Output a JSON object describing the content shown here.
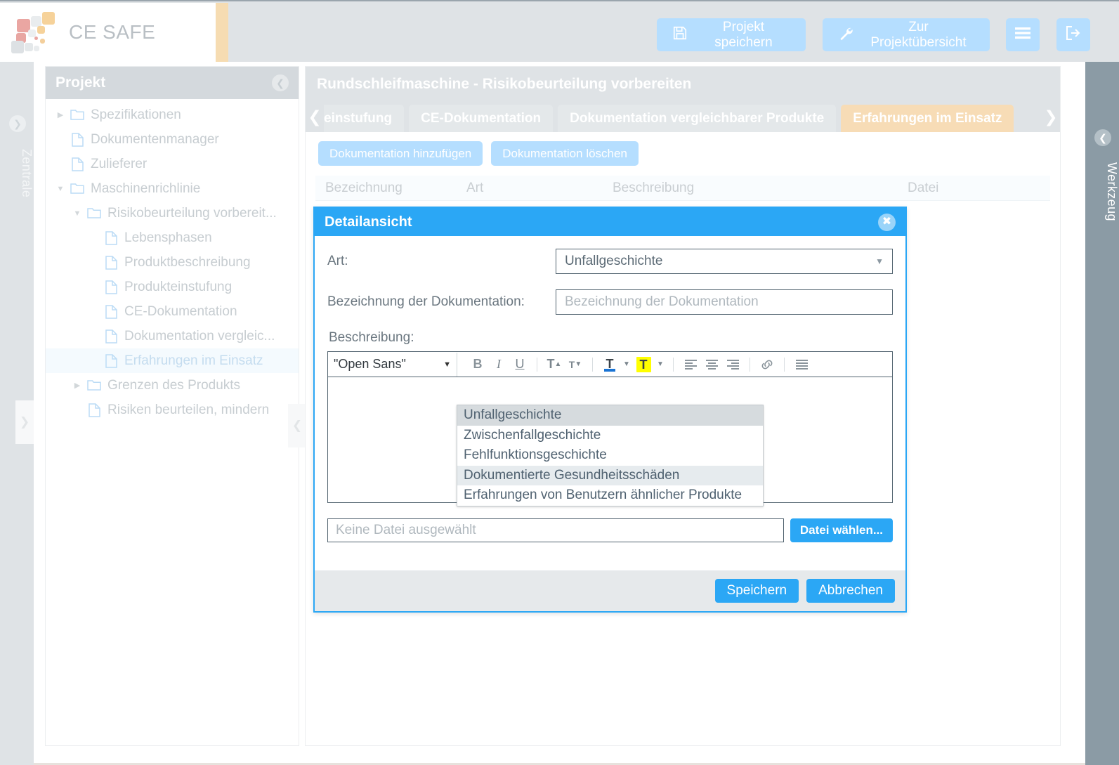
{
  "brand": {
    "name": "CE SAFE"
  },
  "topbar": {
    "save_project": "Projekt speichern",
    "overview": "Zur Projektübersicht",
    "menu_icon": "hamburger-menu-icon",
    "logout_icon": "logout-icon",
    "save_icon": "floppy-disk-icon",
    "wrench_icon": "wrench-icon"
  },
  "rails": {
    "left_label": "Zentrale",
    "right_label": "Werkzeug"
  },
  "tree": {
    "title": "Projekt",
    "items": [
      {
        "label": "Spezifikationen",
        "icon": "folder-icon",
        "indent": 0,
        "caret": "right",
        "selected": false
      },
      {
        "label": "Dokumentenmanager",
        "icon": "document-icon",
        "indent": 0,
        "caret": "none",
        "selected": false
      },
      {
        "label": "Zulieferer",
        "icon": "document-icon",
        "indent": 0,
        "caret": "none",
        "selected": false
      },
      {
        "label": "Maschinenrichlinie",
        "icon": "folder-icon",
        "indent": 0,
        "caret": "down",
        "selected": false
      },
      {
        "label": "Risikobeurteilung vorbereit...",
        "icon": "folder-icon",
        "indent": 1,
        "caret": "down",
        "selected": false
      },
      {
        "label": "Lebensphasen",
        "icon": "document-icon",
        "indent": 2,
        "caret": "none",
        "selected": false
      },
      {
        "label": "Produktbeschreibung",
        "icon": "document-icon",
        "indent": 2,
        "caret": "none",
        "selected": false
      },
      {
        "label": "Produkteinstufung",
        "icon": "document-icon",
        "indent": 2,
        "caret": "none",
        "selected": false
      },
      {
        "label": "CE-Dokumentation",
        "icon": "document-icon",
        "indent": 2,
        "caret": "none",
        "selected": false
      },
      {
        "label": "Dokumentation vergleic...",
        "icon": "document-icon",
        "indent": 2,
        "caret": "none",
        "selected": false
      },
      {
        "label": "Erfahrungen im Einsatz",
        "icon": "document-icon",
        "indent": 2,
        "caret": "none",
        "selected": true
      },
      {
        "label": "Grenzen des Produkts",
        "icon": "folder-icon",
        "indent": 1,
        "caret": "right",
        "selected": false
      },
      {
        "label": "Risiken beurteilen, mindern",
        "icon": "document-icon",
        "indent": 1,
        "caret": "none",
        "selected": false
      }
    ]
  },
  "main": {
    "title": "Rundschleifmaschine - Risikobeurteilung vorbereiten",
    "tab_prev_icon": "chevron-left-icon",
    "tab_next_icon": "chevron-right-icon",
    "tabs": [
      {
        "label": "einstufung",
        "active": false,
        "clipped": true
      },
      {
        "label": "CE-Dokumentation",
        "active": false,
        "clipped": false
      },
      {
        "label": "Dokumentation vergleichbarer Produkte",
        "active": false,
        "clipped": false
      },
      {
        "label": "Erfahrungen im Einsatz",
        "active": true,
        "clipped": false
      }
    ],
    "add_button": "Dokumentation hinzufügen",
    "delete_button": "Dokumentation löschen",
    "table_headers": [
      "Bezeichnung",
      "Art",
      "Beschreibung",
      "Datei"
    ]
  },
  "dialog": {
    "title": "Detailansicht",
    "close_icon": "close-icon",
    "art_label": "Art:",
    "art_value": "Unfallgeschichte",
    "art_arrow_icon": "chevron-down-icon",
    "bezeichnung_label": "Bezeichnung der Dokumentation:",
    "bezeichnung_value": "",
    "bezeichnung_placeholder": "Bezeichnung der Dokumentation",
    "beschreibung_label": "Beschreibung:",
    "editor": {
      "font_value": "\"Open Sans\"",
      "font_arrow_icon": "caret-down-icon",
      "buttons": [
        {
          "name": "bold-icon",
          "glyph": "B",
          "style": "bold"
        },
        {
          "name": "italic-icon",
          "glyph": "I",
          "style": "italic"
        },
        {
          "name": "underline-icon",
          "glyph": "U",
          "style": "underline"
        },
        {
          "name": "superscript-icon",
          "glyph": "T",
          "style": "sup"
        },
        {
          "name": "subscript-icon",
          "glyph": "T",
          "style": "sub"
        },
        {
          "name": "text-color-icon",
          "glyph": "T",
          "style": "textcolor"
        },
        {
          "name": "highlight-color-icon",
          "glyph": "T",
          "style": "highlight"
        },
        {
          "name": "align-left-icon",
          "glyph": "",
          "style": "alignleft"
        },
        {
          "name": "align-center-icon",
          "glyph": "",
          "style": "aligncenter"
        },
        {
          "name": "align-right-icon",
          "glyph": "",
          "style": "alignright"
        },
        {
          "name": "link-icon",
          "glyph": "",
          "style": "link"
        },
        {
          "name": "align-justify-icon",
          "glyph": "",
          "style": "justify"
        }
      ]
    },
    "dropdown_options": [
      {
        "label": "Unfallgeschichte",
        "highlight": "strong"
      },
      {
        "label": "Zwischenfallgeschichte",
        "highlight": "none"
      },
      {
        "label": "Fehlfunktionsgeschichte",
        "highlight": "none"
      },
      {
        "label": "Dokumentierte Gesundheitsschäden",
        "highlight": "soft"
      },
      {
        "label": "Erfahrungen von Benutzern ähnlicher Produkte",
        "highlight": "none"
      }
    ],
    "file_placeholder": "Keine Datei ausgewählt",
    "file_button": "Datei wählen...",
    "save_button": "Speichern",
    "cancel_button": "Abbrechen"
  },
  "colors": {
    "accent_blue": "#2ba7f5",
    "light_blue": "#b5deff",
    "active_tab": "#f7dcb6",
    "panel_gray": "#dfe3e6",
    "rail_right": "#8b9ba5",
    "highlight_yellow": "#ffff00"
  }
}
